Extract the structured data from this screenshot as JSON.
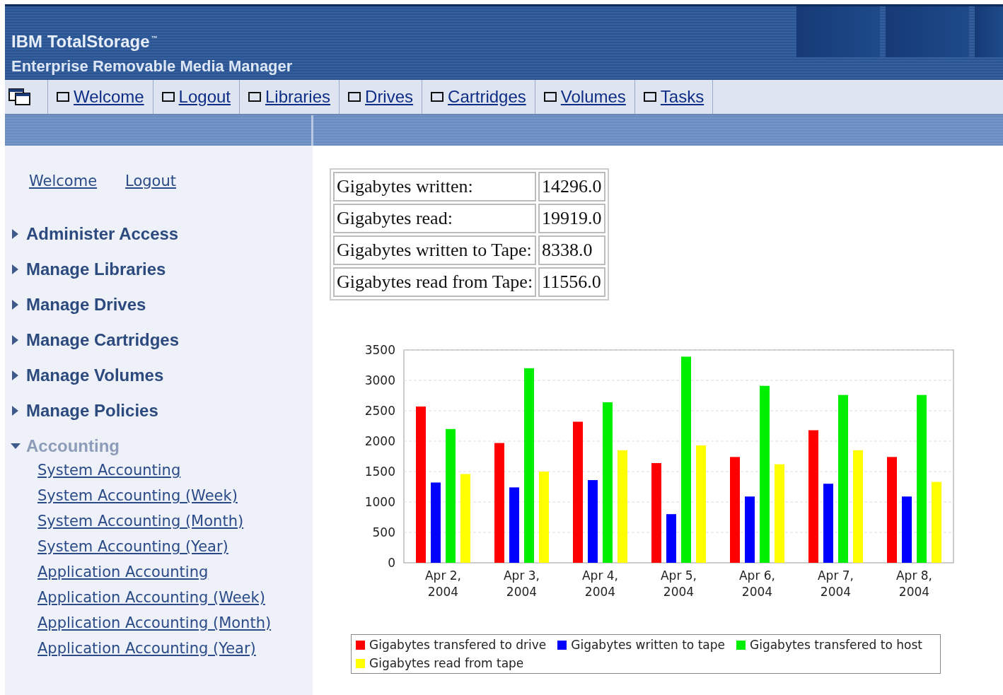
{
  "header": {
    "title": "IBM TotalStorage",
    "trademark": "™",
    "subtitle": "Enterprise Removable Media Manager"
  },
  "nav": {
    "items": [
      {
        "label": "Welcome"
      },
      {
        "label": "Logout"
      },
      {
        "label": "Libraries"
      },
      {
        "label": "Drives"
      },
      {
        "label": "Cartridges"
      },
      {
        "label": "Volumes"
      },
      {
        "label": "Tasks"
      }
    ]
  },
  "sidebar": {
    "links": [
      "Welcome",
      "Logout"
    ],
    "sections": [
      {
        "label": "Administer Access",
        "expanded": false
      },
      {
        "label": "Manage Libraries",
        "expanded": false
      },
      {
        "label": "Manage Drives",
        "expanded": false
      },
      {
        "label": "Manage Cartridges",
        "expanded": false
      },
      {
        "label": "Manage Volumes",
        "expanded": false
      },
      {
        "label": "Manage Policies",
        "expanded": false
      },
      {
        "label": "Accounting",
        "expanded": true,
        "children": [
          "System Accounting",
          "System Accounting (Week)",
          "System Accounting (Month)",
          "System Accounting (Year)",
          "Application Accounting",
          "Application Accounting (Week)",
          "Application Accounting (Month)",
          "Application Accounting (Year)"
        ]
      }
    ]
  },
  "stats": [
    {
      "label": "Gigabytes written:",
      "value": "14296.0"
    },
    {
      "label": "Gigabytes read:",
      "value": "19919.0"
    },
    {
      "label": "Gigabytes written to Tape:",
      "value": "8338.0"
    },
    {
      "label": "Gigabytes read from Tape:",
      "value": "11556.0"
    }
  ],
  "chart_data": {
    "type": "bar",
    "categories": [
      "Apr 2, 2004",
      "Apr 3, 2004",
      "Apr 4, 2004",
      "Apr 5, 2004",
      "Apr 6, 2004",
      "Apr 7, 2004",
      "Apr 8, 2004"
    ],
    "series": [
      {
        "name": "Gigabytes transfered to drive",
        "color": "#ff0000",
        "values": [
          2570,
          1970,
          2320,
          1640,
          1740,
          2180,
          1740
        ]
      },
      {
        "name": "Gigabytes written to tape",
        "color": "#0000ff",
        "values": [
          1320,
          1240,
          1360,
          800,
          1090,
          1300,
          1090
        ]
      },
      {
        "name": "Gigabytes transfered to host",
        "color": "#00ee00",
        "values": [
          2200,
          3200,
          2640,
          3390,
          2910,
          2760,
          2760
        ]
      },
      {
        "name": "Gigabytes read from tape",
        "color": "#ffff00",
        "values": [
          1460,
          1500,
          1850,
          1930,
          1620,
          1850,
          1330
        ]
      }
    ],
    "grid": true,
    "ylim": [
      0,
      3500
    ],
    "yticks": [
      0,
      500,
      1000,
      1500,
      2000,
      2500,
      3000,
      3500
    ]
  }
}
